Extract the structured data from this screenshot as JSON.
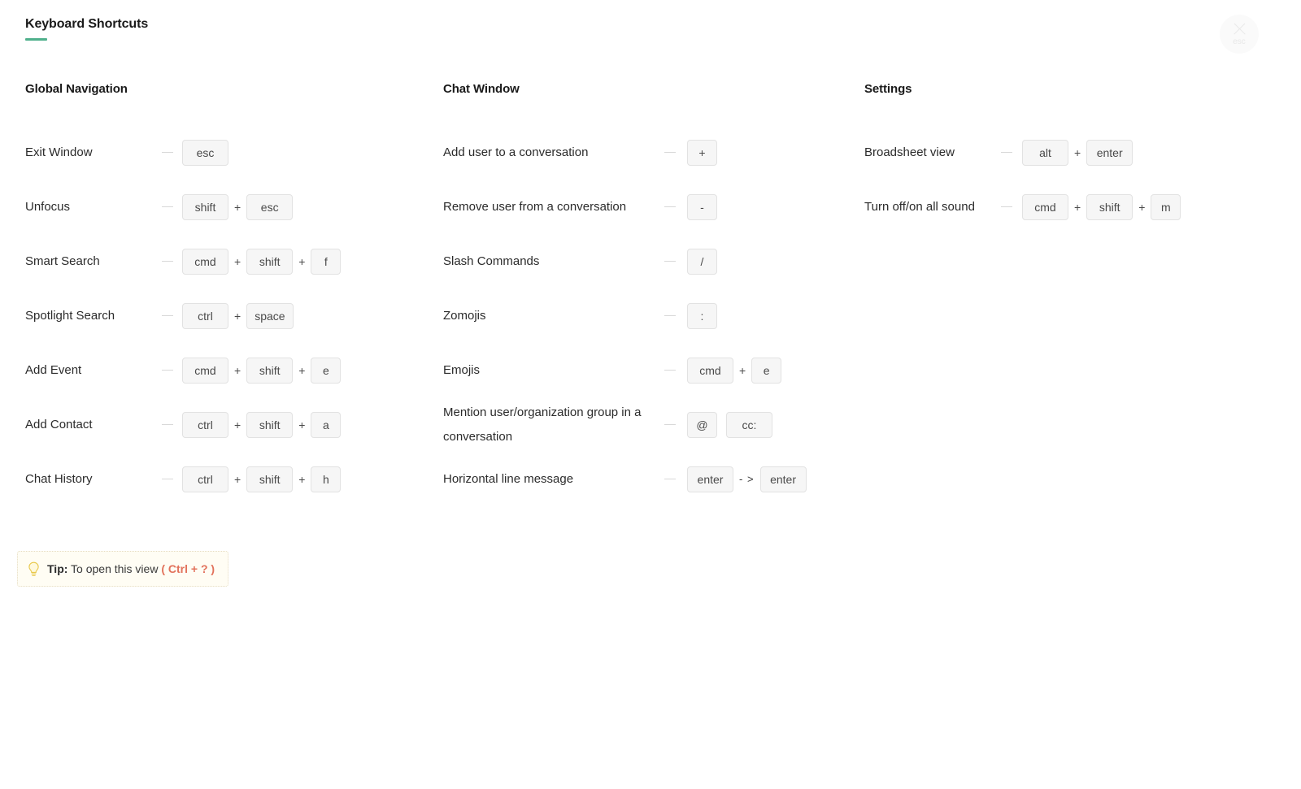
{
  "header": {
    "title": "Keyboard Shortcuts",
    "accent_color": "#4fb08c"
  },
  "close_button": {
    "icon": "close-icon",
    "label": "esc"
  },
  "columns": [
    {
      "title": "Global Navigation",
      "shortcuts": [
        {
          "label": "Exit Window",
          "keys": [
            "esc"
          ],
          "separators": []
        },
        {
          "label": "Unfocus",
          "keys": [
            "shift",
            "esc"
          ],
          "separators": [
            "+"
          ]
        },
        {
          "label": "Smart Search",
          "keys": [
            "cmd",
            "shift",
            "f"
          ],
          "separators": [
            "+",
            "+"
          ]
        },
        {
          "label": "Spotlight Search",
          "keys": [
            "ctrl",
            "space"
          ],
          "separators": [
            "+"
          ]
        },
        {
          "label": "Add Event",
          "keys": [
            "cmd",
            "shift",
            "e"
          ],
          "separators": [
            "+",
            "+"
          ]
        },
        {
          "label": "Add Contact",
          "keys": [
            "ctrl",
            "shift",
            "a"
          ],
          "separators": [
            "+",
            "+"
          ]
        },
        {
          "label": "Chat History",
          "keys": [
            "ctrl",
            "shift",
            "h"
          ],
          "separators": [
            "+",
            "+"
          ]
        }
      ]
    },
    {
      "title": "Chat Window",
      "shortcuts": [
        {
          "label": "Add user to a conversation",
          "keys": [
            "+"
          ],
          "separators": []
        },
        {
          "label": "Remove user from a conversation",
          "keys": [
            "-"
          ],
          "separators": []
        },
        {
          "label": "Slash Commands",
          "keys": [
            "/"
          ],
          "separators": []
        },
        {
          "label": "Zomojis",
          "keys": [
            ":"
          ],
          "separators": []
        },
        {
          "label": "Emojis",
          "keys": [
            "cmd",
            "e"
          ],
          "separators": [
            "+"
          ]
        },
        {
          "label": "Mention user/organization group in a conversation",
          "keys": [
            "@",
            "cc:"
          ],
          "separators": [
            ""
          ]
        },
        {
          "label": "Horizontal line message",
          "keys": [
            "enter",
            "enter"
          ],
          "separators": [
            "- >"
          ]
        }
      ]
    },
    {
      "title": "Settings",
      "shortcuts": [
        {
          "label": "Broadsheet view",
          "keys": [
            "alt",
            "enter"
          ],
          "separators": [
            "+"
          ]
        },
        {
          "label": "Turn off/on all sound",
          "keys": [
            "cmd",
            "shift",
            "m"
          ],
          "separators": [
            "+",
            "+"
          ]
        }
      ]
    }
  ],
  "tip": {
    "icon": "lightbulb-icon",
    "strong": "Tip:",
    "text": " To open this view ",
    "combo": "( Ctrl + ? )",
    "combo_color": "#e2725b"
  }
}
